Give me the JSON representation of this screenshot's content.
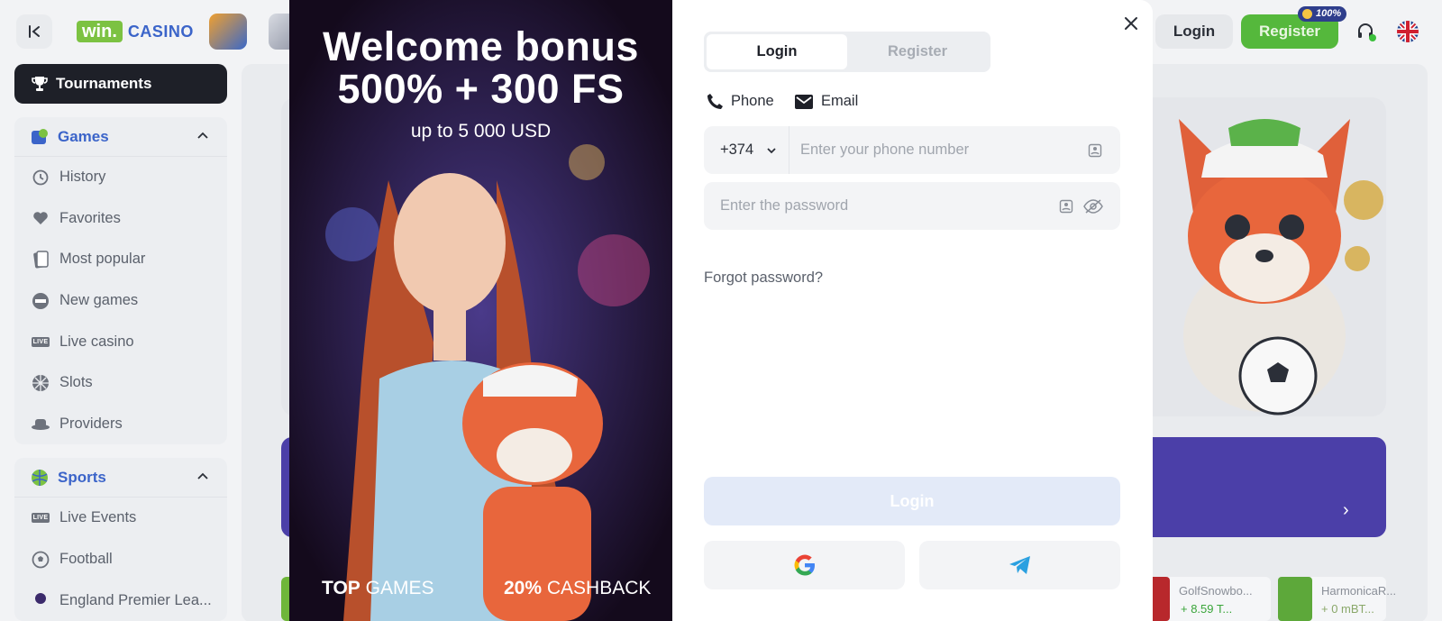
{
  "header": {
    "logo_win": "win.",
    "logo_casino": "CASINO",
    "login_label": "Login",
    "register_label": "Register",
    "register_badge": "100%"
  },
  "sidebar": {
    "tournaments": "Tournaments",
    "games_section": "Games",
    "games_items": [
      {
        "label": "History",
        "icon": "history-icon"
      },
      {
        "label": "Favorites",
        "icon": "heart-icon"
      },
      {
        "label": "Most popular",
        "icon": "cards-icon"
      },
      {
        "label": "New games",
        "icon": "new-icon"
      },
      {
        "label": "Live casino",
        "icon": "live-icon"
      },
      {
        "label": "Slots",
        "icon": "slots-icon"
      },
      {
        "label": "Providers",
        "icon": "hat-icon"
      }
    ],
    "sports_section": "Sports",
    "sports_items": [
      {
        "label": "Live Events",
        "icon": "live-icon"
      },
      {
        "label": "Football",
        "icon": "football-icon"
      },
      {
        "label": "England Premier Lea...",
        "icon": "trophy-icon"
      }
    ],
    "live_tag": "LIVE"
  },
  "game_strip": [
    {
      "name": "GolfSnowbo...",
      "value": "+ 8.59 T..."
    },
    {
      "name": "HarmonicaR...",
      "value": "+ 0 mBT..."
    }
  ],
  "modal": {
    "promo": {
      "title_line1": "Welcome bonus",
      "title_line2": "500% + 300 FS",
      "subtitle": "up to 5 000 USD",
      "bottom_left_bold": "TOP",
      "bottom_left_rest": " GAMES",
      "bottom_right_bold": "20%",
      "bottom_right_rest": " CASHBACK"
    },
    "tabs": {
      "login": "Login",
      "register": "Register"
    },
    "methods": {
      "phone": "Phone",
      "email": "Email"
    },
    "phone": {
      "country_code": "+374",
      "placeholder": "Enter your phone number"
    },
    "password": {
      "placeholder": "Enter the password"
    },
    "forgot": "Forgot password?",
    "submit": "Login"
  },
  "colors": {
    "accent_blue": "#3b64c9",
    "register_green": "#55b83c",
    "dark": "#1e2028"
  }
}
